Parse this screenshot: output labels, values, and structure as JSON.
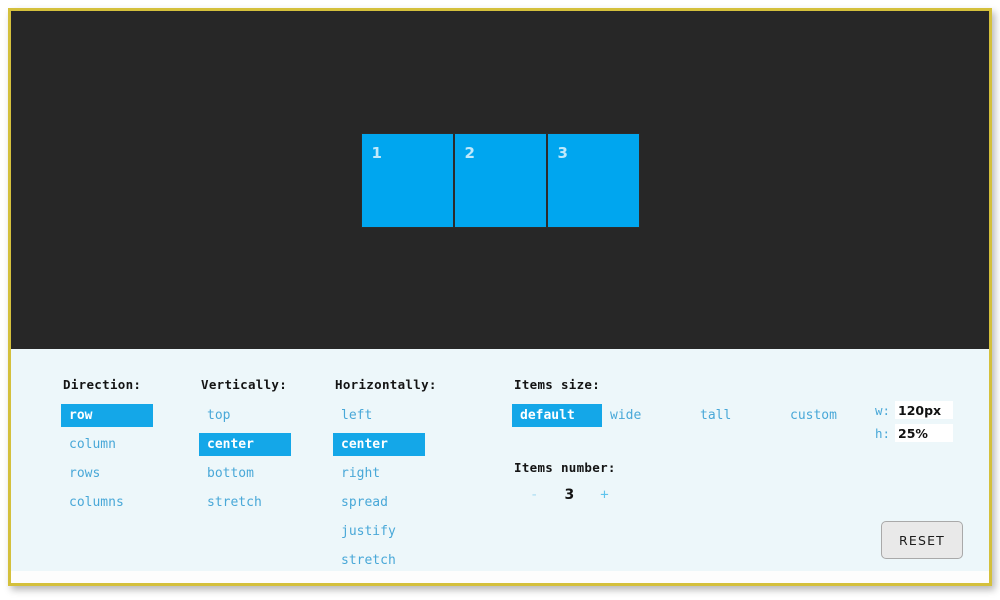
{
  "theme": {
    "page_border_color": "#d4c03c",
    "canvas_background": "#272727",
    "panel_background": "#edf7fa",
    "accent_color": "#14a7e8",
    "option_text_color": "#49a8d8",
    "item_color": "#00a6ef",
    "item_label_color": "#bfe9fb"
  },
  "preview": {
    "direction": "row",
    "items": [
      {
        "label": "1"
      },
      {
        "label": "2"
      },
      {
        "label": "3"
      }
    ]
  },
  "controls": {
    "direction": {
      "title": "Direction:",
      "options": [
        {
          "label": "row",
          "selected": true
        },
        {
          "label": "column",
          "selected": false
        },
        {
          "label": "rows",
          "selected": false
        },
        {
          "label": "columns",
          "selected": false
        }
      ]
    },
    "vertically": {
      "title": "Vertically:",
      "options": [
        {
          "label": "top",
          "selected": false
        },
        {
          "label": "center",
          "selected": true
        },
        {
          "label": "bottom",
          "selected": false
        },
        {
          "label": "stretch",
          "selected": false
        }
      ]
    },
    "horizontally": {
      "title": "Horizontally:",
      "options": [
        {
          "label": "left",
          "selected": false
        },
        {
          "label": "center",
          "selected": true
        },
        {
          "label": "right",
          "selected": false
        },
        {
          "label": "spread",
          "selected": false
        },
        {
          "label": "justify",
          "selected": false
        },
        {
          "label": "stretch",
          "selected": false
        }
      ]
    },
    "items_size": {
      "title": "Items size:",
      "options": [
        {
          "label": "default",
          "selected": true
        },
        {
          "label": "wide",
          "selected": false
        },
        {
          "label": "tall",
          "selected": false
        },
        {
          "label": "custom",
          "selected": false
        }
      ],
      "width_label": "w:",
      "width_value": "120px",
      "height_label": "h:",
      "height_value": "25%"
    },
    "items_number": {
      "title": "Items number:",
      "decrement_label": "-",
      "value": "3",
      "increment_label": "+"
    },
    "reset_label": "RESET"
  }
}
